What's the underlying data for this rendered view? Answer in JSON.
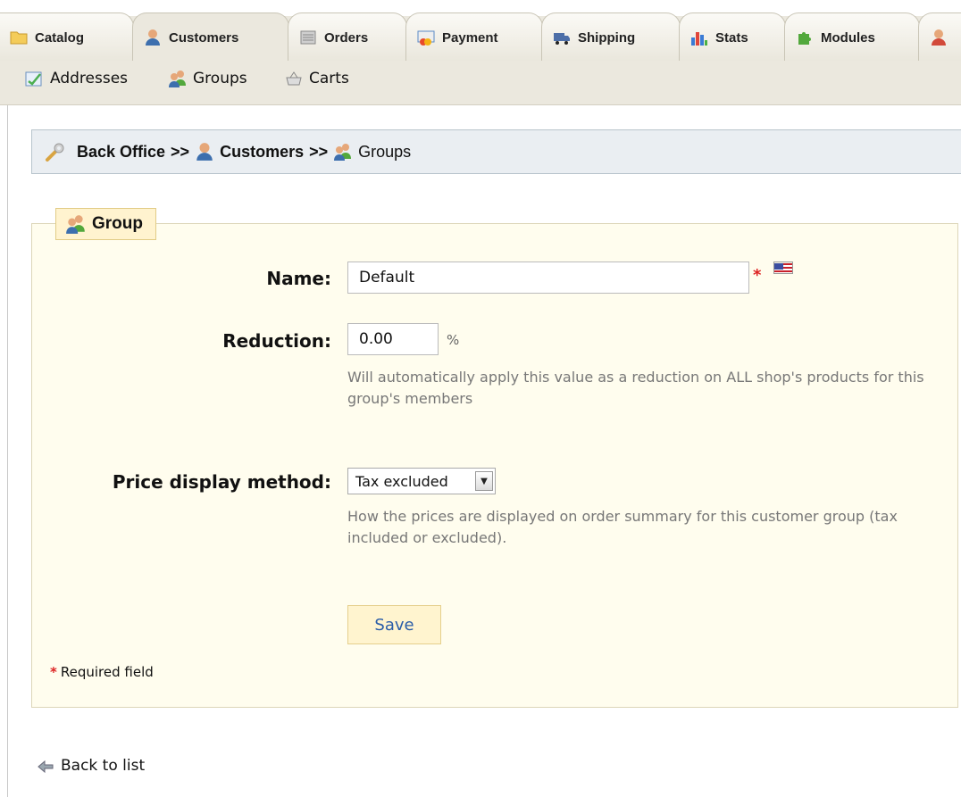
{
  "tabs": [
    {
      "label": "Catalog",
      "icon": "folder-icon",
      "active": false
    },
    {
      "label": "Customers",
      "icon": "customer-icon",
      "active": true
    },
    {
      "label": "Orders",
      "icon": "cart-icon",
      "active": false
    },
    {
      "label": "Payment",
      "icon": "payment-icon",
      "active": false
    },
    {
      "label": "Shipping",
      "icon": "truck-icon",
      "active": false
    },
    {
      "label": "Stats",
      "icon": "bar-chart-icon",
      "active": false
    },
    {
      "label": "Modules",
      "icon": "puzzle-icon",
      "active": false
    }
  ],
  "subtabs": [
    {
      "label": "Addresses",
      "icon": "address-icon"
    },
    {
      "label": "Groups",
      "icon": "group-icon"
    },
    {
      "label": "Carts",
      "icon": "basket-icon"
    }
  ],
  "breadcrumb": {
    "root": "Back Office",
    "separator": ">>",
    "level1": "Customers",
    "level2": "Groups"
  },
  "form": {
    "legend": "Group",
    "name_label": "Name:",
    "name_value": "Default",
    "reduction_label": "Reduction:",
    "reduction_value": "0.00",
    "reduction_unit": "%",
    "reduction_hint": "Will automatically apply this value as a reduction on ALL shop's products for this group's members",
    "price_display_label": "Price display method:",
    "price_display_value": "Tax excluded",
    "price_display_hint": "How the prices are displayed on order summary for this customer group (tax included or excluded).",
    "required_star": "*",
    "save_label": "Save",
    "required_note": "Required field"
  },
  "footer": {
    "back_label": "Back to list"
  },
  "colors": {
    "tab_bg": "#ebe8de",
    "breadcrumb_bg": "#eaeef2",
    "panel_bg": "#fffdee",
    "legend_bg": "#fff3cf",
    "save_text": "#2a5da8",
    "required": "#dd2222"
  }
}
